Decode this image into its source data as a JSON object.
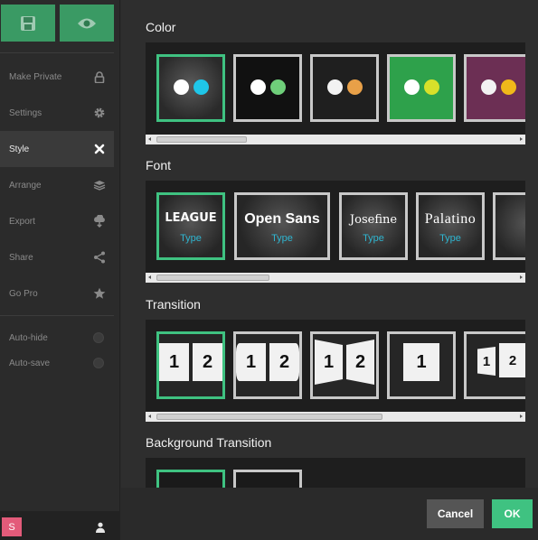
{
  "sidebar": {
    "top_buttons": {
      "save_icon": "save-icon",
      "preview_icon": "eye-icon"
    },
    "items": [
      {
        "label": "Make Private",
        "icon": "lock-icon"
      },
      {
        "label": "Settings",
        "icon": "gear-icon"
      },
      {
        "label": "Style",
        "icon": "close-icon",
        "active": true
      },
      {
        "label": "Arrange",
        "icon": "layers-icon"
      },
      {
        "label": "Export",
        "icon": "export-icon"
      },
      {
        "label": "Share",
        "icon": "share-icon"
      },
      {
        "label": "Go Pro",
        "icon": "star-icon"
      }
    ],
    "toggles": [
      {
        "label": "Auto-hide",
        "on": false
      },
      {
        "label": "Auto-save",
        "on": false
      }
    ],
    "logo_letter": "S",
    "user_icon": "user-icon"
  },
  "sections": {
    "color": {
      "title": "Color",
      "themes": [
        {
          "bg": "#3a3a3a",
          "dots": [
            "#ffffff",
            "#1fc6e8"
          ],
          "selected": true
        },
        {
          "bg": "#111111",
          "dots": [
            "#ffffff",
            "#6fcf7a"
          ],
          "selected": false
        },
        {
          "bg": "#1f1f1f",
          "dots": [
            "#f2f2f2",
            "#e8a048"
          ],
          "selected": false
        },
        {
          "bg": "#2ea14b",
          "dots": [
            "#ffffff",
            "#d8e02a"
          ],
          "selected": false
        },
        {
          "bg": "#6c2f54",
          "dots": [
            "#f2f2f2",
            "#f0b91a"
          ],
          "selected": false
        }
      ]
    },
    "font": {
      "title": "Font",
      "type_label": "Type",
      "fonts": [
        {
          "name": "LEAGUE",
          "selected": true
        },
        {
          "name": "Open Sans",
          "selected": false
        },
        {
          "name": "Josefine",
          "selected": false
        },
        {
          "name": "Palatino",
          "selected": false
        }
      ]
    },
    "transition": {
      "title": "Transition",
      "cards": [
        {
          "labels": [
            "1",
            "2"
          ],
          "style": "flat",
          "selected": true
        },
        {
          "labels": [
            "1",
            "2"
          ],
          "style": "concave",
          "selected": false
        },
        {
          "labels": [
            "1",
            "2"
          ],
          "style": "convex",
          "selected": false
        },
        {
          "labels": [
            "1"
          ],
          "style": "single",
          "selected": false
        },
        {
          "labels": [
            "1",
            "2"
          ],
          "style": "rotate",
          "selected": false
        }
      ]
    },
    "bg_transition": {
      "title": "Background Transition"
    }
  },
  "footer": {
    "cancel_label": "Cancel",
    "ok_label": "OK"
  }
}
